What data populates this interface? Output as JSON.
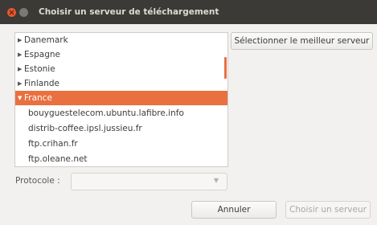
{
  "window": {
    "title": "Choisir un serveur de téléchargement"
  },
  "tree": {
    "countries": [
      {
        "label": "Danemark",
        "arrow": "▶"
      },
      {
        "label": "Espagne",
        "arrow": "▶"
      },
      {
        "label": "Estonie",
        "arrow": "▶"
      },
      {
        "label": "Finlande",
        "arrow": "▶"
      },
      {
        "label": "France",
        "arrow": "▼"
      }
    ],
    "servers": [
      "bouyguestelecom.ubuntu.lafibre.info",
      "distrib-coffee.ipsl.jussieu.fr",
      "ftp.crihan.fr",
      "ftp.oleane.net"
    ],
    "selected": "France"
  },
  "buttons": {
    "best_server": "Sélectionner le meilleur serveur",
    "cancel": "Annuler",
    "choose": "Choisir un serveur"
  },
  "protocol": {
    "label": "Protocole :",
    "value": ""
  },
  "colors": {
    "accent": "#e9703f",
    "titlebar": "#3b3a36",
    "close_button": "#e9572d"
  }
}
